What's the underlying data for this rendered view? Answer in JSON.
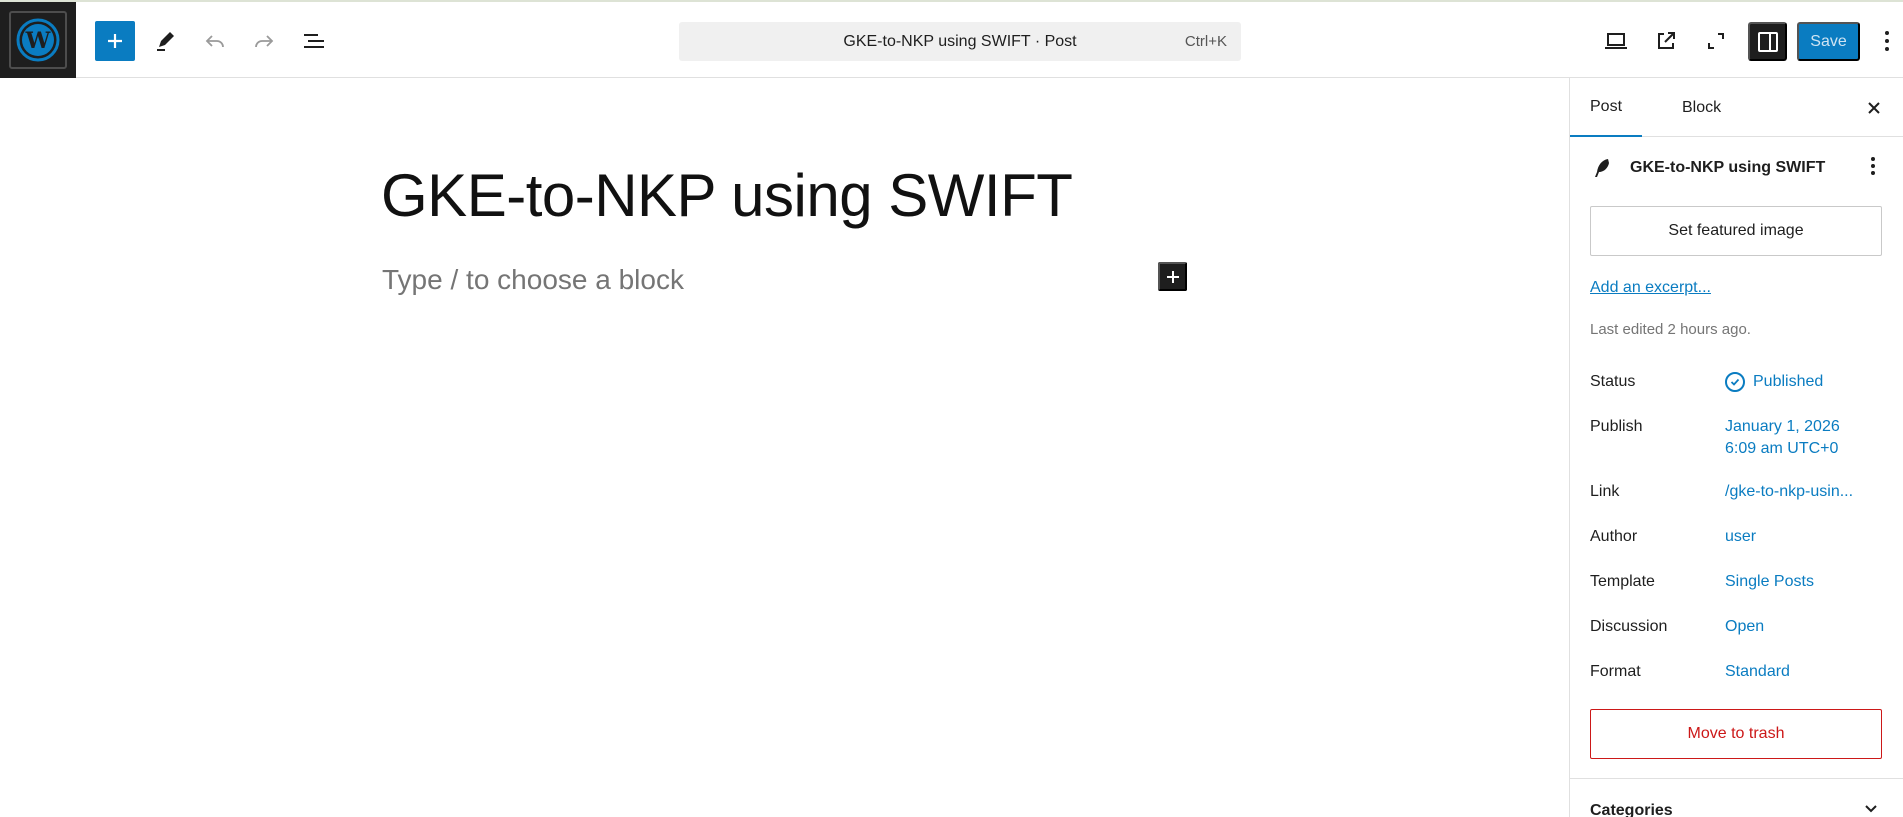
{
  "toolbar": {
    "command_title": "GKE-to-NKP using SWIFT · Post",
    "command_shortcut": "Ctrl+K",
    "save_label": "Save"
  },
  "editor": {
    "post_title": "GKE-to-NKP using SWIFT",
    "block_placeholder": "Type / to choose a block"
  },
  "sidebar": {
    "tabs": [
      {
        "label": "Post"
      },
      {
        "label": "Block"
      }
    ],
    "post_card_title": "GKE-to-NKP using SWIFT",
    "featured_image_label": "Set featured image",
    "add_excerpt_label": "Add an excerpt...",
    "last_edited": "Last edited 2 hours ago.",
    "rows": {
      "status": {
        "label": "Status",
        "value": "Published"
      },
      "publish": {
        "label": "Publish",
        "value_line1": "January 1, 2026",
        "value_line2": "6:09 am UTC+0"
      },
      "link": {
        "label": "Link",
        "value": "/gke-to-nkp-usin..."
      },
      "author": {
        "label": "Author",
        "value": "user"
      },
      "template": {
        "label": "Template",
        "value": "Single Posts"
      },
      "discussion": {
        "label": "Discussion",
        "value": "Open"
      },
      "format": {
        "label": "Format",
        "value": "Standard"
      }
    },
    "trash_label": "Move to trash",
    "categories_label": "Categories"
  },
  "colors": {
    "accent": "#0a7cc1",
    "dark": "#1e1e1e",
    "danger": "#cc1818",
    "muted": "#757575"
  },
  "icons": [
    "wordpress-logo-icon",
    "plus-icon",
    "pen-icon",
    "undo-icon",
    "redo-icon",
    "list-view-icon",
    "desktop-preview-icon",
    "external-link-icon",
    "fullscreen-icon",
    "sidebar-toggle-icon",
    "more-vertical-icon",
    "close-icon",
    "feather-icon",
    "check-circle-icon",
    "chevron-down-icon"
  ]
}
